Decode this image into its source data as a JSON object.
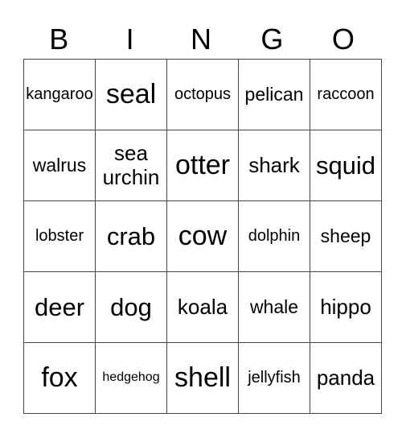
{
  "header": [
    "B",
    "I",
    "N",
    "G",
    "O"
  ],
  "cells": [
    [
      "kangaroo",
      "seal",
      "octopus",
      "pelican",
      "raccoon"
    ],
    [
      "walrus",
      "sea urchin",
      "otter",
      "shark",
      "squid"
    ],
    [
      "lobster",
      "crab",
      "cow",
      "dolphin",
      "sheep"
    ],
    [
      "deer",
      "dog",
      "koala",
      "whale",
      "hippo"
    ],
    [
      "fox",
      "hedgehog",
      "shell",
      "jellyfish",
      "panda"
    ]
  ]
}
